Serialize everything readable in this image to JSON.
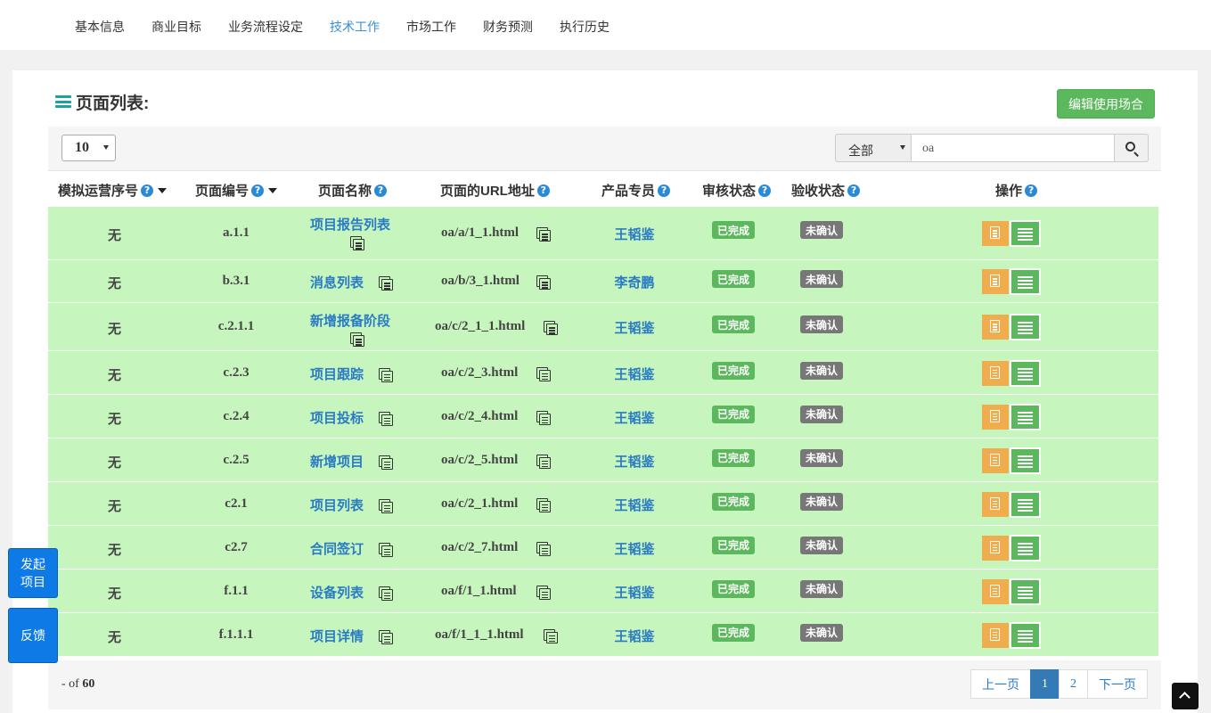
{
  "nav": {
    "tabs": [
      {
        "label": "基本信息"
      },
      {
        "label": "商业目标"
      },
      {
        "label": "业务流程设定"
      },
      {
        "label": "技术工作"
      },
      {
        "label": "市场工作"
      },
      {
        "label": "财务预测"
      },
      {
        "label": "执行历史"
      }
    ],
    "active_tab": "技术工作"
  },
  "panel": {
    "title": "页面列表:",
    "edit_button": "编辑使用场合"
  },
  "toolbar": {
    "page_size": "10",
    "filter": "全部",
    "search_value": "oa"
  },
  "columns": {
    "seq": "模拟运营序号",
    "code": "页面编号",
    "name": "页面名称",
    "url": "页面的URL地址",
    "owner": "产品专员",
    "review": "审核状态",
    "accept": "验收状态",
    "ops": "操作",
    "help_glyph": "?"
  },
  "rows": [
    {
      "seq": "无",
      "code": "a.1.1",
      "name": "项目报告列表",
      "url": "oa/a/1_1.html",
      "owner": "王韬鉴",
      "review": "已完成",
      "accept": "未确认"
    },
    {
      "seq": "无",
      "code": "b.3.1",
      "name": "消息列表",
      "url": "oa/b/3_1.html",
      "owner": "李奇鹏",
      "review": "已完成",
      "accept": "未确认"
    },
    {
      "seq": "无",
      "code": "c.2.1.1",
      "name": "新增报备阶段",
      "url": "oa/c/2_1_1.html",
      "owner": "王韬鉴",
      "review": "已完成",
      "accept": "未确认"
    },
    {
      "seq": "无",
      "code": "c.2.3",
      "name": "项目跟踪",
      "url": "oa/c/2_3.html",
      "owner": "王韬鉴",
      "review": "已完成",
      "accept": "未确认"
    },
    {
      "seq": "无",
      "code": "c.2.4",
      "name": "项目投标",
      "url": "oa/c/2_4.html",
      "owner": "王韬鉴",
      "review": "已完成",
      "accept": "未确认"
    },
    {
      "seq": "无",
      "code": "c.2.5",
      "name": "新增项目",
      "url": "oa/c/2_5.html",
      "owner": "王韬鉴",
      "review": "已完成",
      "accept": "未确认"
    },
    {
      "seq": "无",
      "code": "c2.1",
      "name": "项目列表",
      "url": "oa/c/2_1.html",
      "owner": "王韬鉴",
      "review": "已完成",
      "accept": "未确认"
    },
    {
      "seq": "无",
      "code": "c2.7",
      "name": "合同签订",
      "url": "oa/c/2_7.html",
      "owner": "王韬鉴",
      "review": "已完成",
      "accept": "未确认"
    },
    {
      "seq": "无",
      "code": "f.1.1",
      "name": "设备列表",
      "url": "oa/f/1_1.html",
      "owner": "王韬鉴",
      "review": "已完成",
      "accept": "未确认"
    },
    {
      "seq": "无",
      "code": "f.1.1.1",
      "name": "项目详情",
      "url": "oa/f/1_1_1.html",
      "owner": "王韬鉴",
      "review": "已完成",
      "accept": "未确认"
    }
  ],
  "footer": {
    "count_prefix": "- of",
    "total": "60"
  },
  "pagination": {
    "prev": "上一页",
    "pages": [
      "1",
      "2"
    ],
    "current": "1",
    "next": "下一页"
  },
  "floating": {
    "start_project": "发起项目",
    "feedback": "反馈"
  },
  "icons": {
    "title": "list-icon",
    "search": "search-icon",
    "copy": "copy-icon",
    "doc_op": "file-text-icon",
    "list_op": "list-icon",
    "help": "question-circle-icon",
    "sort": "caret-down-icon",
    "scroll_top": "chevron-up-icon"
  },
  "colors": {
    "row_bg": "#c6f5bd",
    "active_tab": "#3a8fd6",
    "link": "#2a7bc4",
    "success": "#5cb85c",
    "warning": "#f0ad4e",
    "muted_label": "#777777",
    "primary": "#337ab7",
    "float_button": "#0e7ae6"
  }
}
